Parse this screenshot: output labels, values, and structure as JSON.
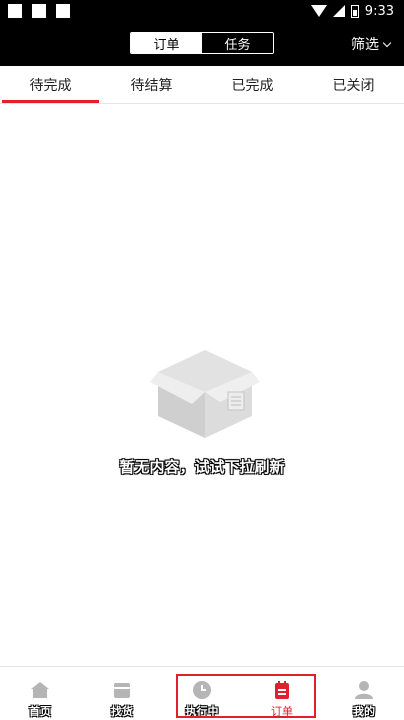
{
  "status_bar": {
    "time": "9:33"
  },
  "header": {
    "segments": [
      {
        "label": "订单",
        "active": true
      },
      {
        "label": "任务",
        "active": false
      }
    ],
    "filter_label": "筛选"
  },
  "tabs": [
    {
      "label": "待完成",
      "active": true
    },
    {
      "label": "待结算",
      "active": false
    },
    {
      "label": "已完成",
      "active": false
    },
    {
      "label": "已关闭",
      "active": false
    }
  ],
  "empty_state": {
    "message": "暂无内容，试试下拉刷新",
    "icon": "empty-box-icon"
  },
  "bottom_nav": [
    {
      "label": "首页",
      "icon": "home-icon",
      "active": false
    },
    {
      "label": "找货",
      "icon": "cargo-icon",
      "active": false
    },
    {
      "label": "执行中",
      "icon": "clock-icon",
      "active": false
    },
    {
      "label": "订单",
      "icon": "order-icon",
      "active": true
    },
    {
      "label": "我的",
      "icon": "user-icon",
      "active": false
    }
  ],
  "colors": {
    "accent": "#e0212d",
    "header_bg": "#000000",
    "icon_gray": "#b5b5b5"
  }
}
